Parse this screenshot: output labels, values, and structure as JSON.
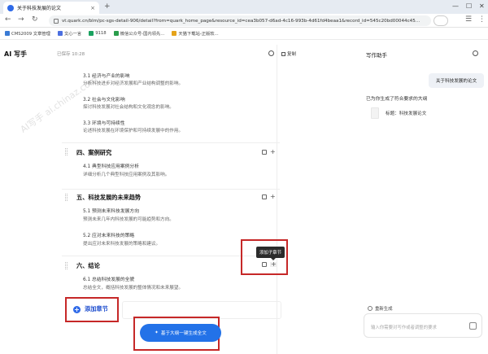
{
  "browser": {
    "tab_title": "关于科技发展的论文",
    "new_tab_symbol": "+",
    "url": "vt.quark.cn/blm/pc-sgs-detail-906/detail?from=quark_home_page&resource_id=cea3b057-d6ad-4c16-993b-4d61fd4beaa1&record_id=545c20bd00044c45...",
    "bookmarks": [
      {
        "label": "CMS2009 文章管理",
        "color": "#3a7bd5"
      },
      {
        "label": "文心一言",
        "color": "#4b6fe0"
      },
      {
        "label": "9118",
        "color": "#1aa260"
      },
      {
        "label": "微信公众号-国内领先...",
        "color": "#2a9d4b"
      },
      {
        "label": "天猫下载站-正版软...",
        "color": "#e5a31a"
      }
    ]
  },
  "header": {
    "logo": "AI 写手",
    "saved_status": "已保存 10:28",
    "copy_label": "复制",
    "assistant_title": "写作助手"
  },
  "outline": {
    "top_items": [
      {
        "title": "3.1 经济与产业的影响",
        "desc": "分析科技进步对经济发展和产业结构调整的影响。"
      },
      {
        "title": "3.2 社会与文化影响",
        "desc": "探讨科技发展对社会结构和文化观念的影响。"
      },
      {
        "title": "3.3 环境与可持续性",
        "desc": "论述科技发展在环境保护和可持续发展中的作用。"
      }
    ],
    "sections": [
      {
        "title": "四、案例研究",
        "items": [
          {
            "title": "4.1 典型科技应用案例分析",
            "desc": "详细分析几个典型科技应用案例及其影响。"
          }
        ]
      },
      {
        "title": "五、科技发展的未来趋势",
        "items": [
          {
            "title": "5.1 预测未来科技发展方向",
            "desc": "预测未来几年内科技发展的可能趋势和方向。"
          },
          {
            "title": "5.2 应对未来科技的策略",
            "desc": "提出应对未来科技发展的策略和建议。"
          }
        ]
      },
      {
        "title": "六、结论",
        "items": [
          {
            "title": "6.1 总结科技发展的全貌",
            "desc": "总结全文，概括科技发展的整体情况和未来展望。"
          }
        ]
      }
    ],
    "tooltip": "添加子章节",
    "add_chapter": "添加章节",
    "generate_button": "基于大纲一键生成全文"
  },
  "assistant": {
    "user_message": "关于科技发展的论文",
    "generated_note": "已为你生成了符合要求的大纲",
    "doc_title": "标题：科技发展论文",
    "regenerate": "重新生成",
    "input_placeholder": "输入你需要对写作或者调整的要求"
  },
  "colors": {
    "accent": "#2372e8",
    "highlight_frame": "#c62828"
  },
  "watermark": "AI写手 ai.chinaz.com"
}
